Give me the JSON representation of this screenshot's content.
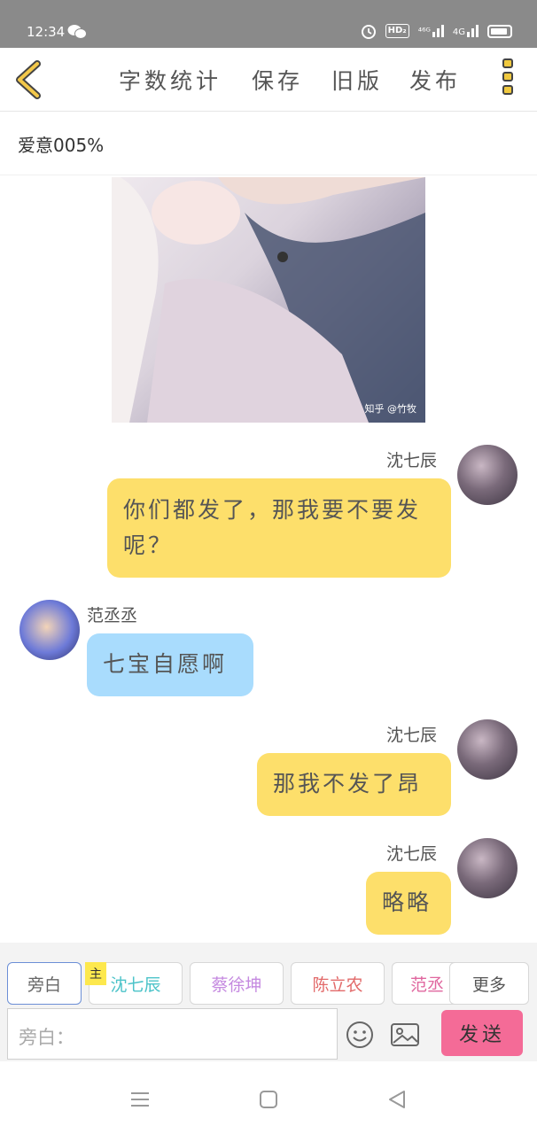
{
  "status": {
    "time": "12:34",
    "hd": "HD₂",
    "net1": "⁴⁶ᴳ",
    "net2": "4G"
  },
  "toolbar": {
    "items": [
      "字数统计",
      "保存",
      "旧版",
      "发布"
    ]
  },
  "doc": {
    "title": "爱意005%"
  },
  "photo": {
    "watermark": "知乎 @竹牧"
  },
  "messages": [
    {
      "sender": "沈七辰",
      "text": "你们都发了，那我要不要发呢？",
      "side": "right"
    },
    {
      "sender": "范丞丞",
      "text": "七宝自愿啊",
      "side": "left"
    },
    {
      "sender": "沈七辰",
      "text": "那我不发了昂",
      "side": "right"
    },
    {
      "sender": "沈七辰",
      "text": "略略",
      "side": "right"
    }
  ],
  "roles": {
    "chips": [
      "旁白",
      "沈七辰",
      "蔡徐坤",
      "陈立农",
      "范丞"
    ],
    "main_tag": "主",
    "more": "更多",
    "colors": [
      "#666666",
      "#4cc3c9",
      "#c58ae0",
      "#e26a6a",
      "#e0679f"
    ]
  },
  "input": {
    "placeholder": "旁白：",
    "send": "发送"
  },
  "icons": [
    "back-icon",
    "more-vertical-icon",
    "emoji-icon",
    "image-icon",
    "menu-icon",
    "home-icon",
    "back-triangle-icon"
  ]
}
